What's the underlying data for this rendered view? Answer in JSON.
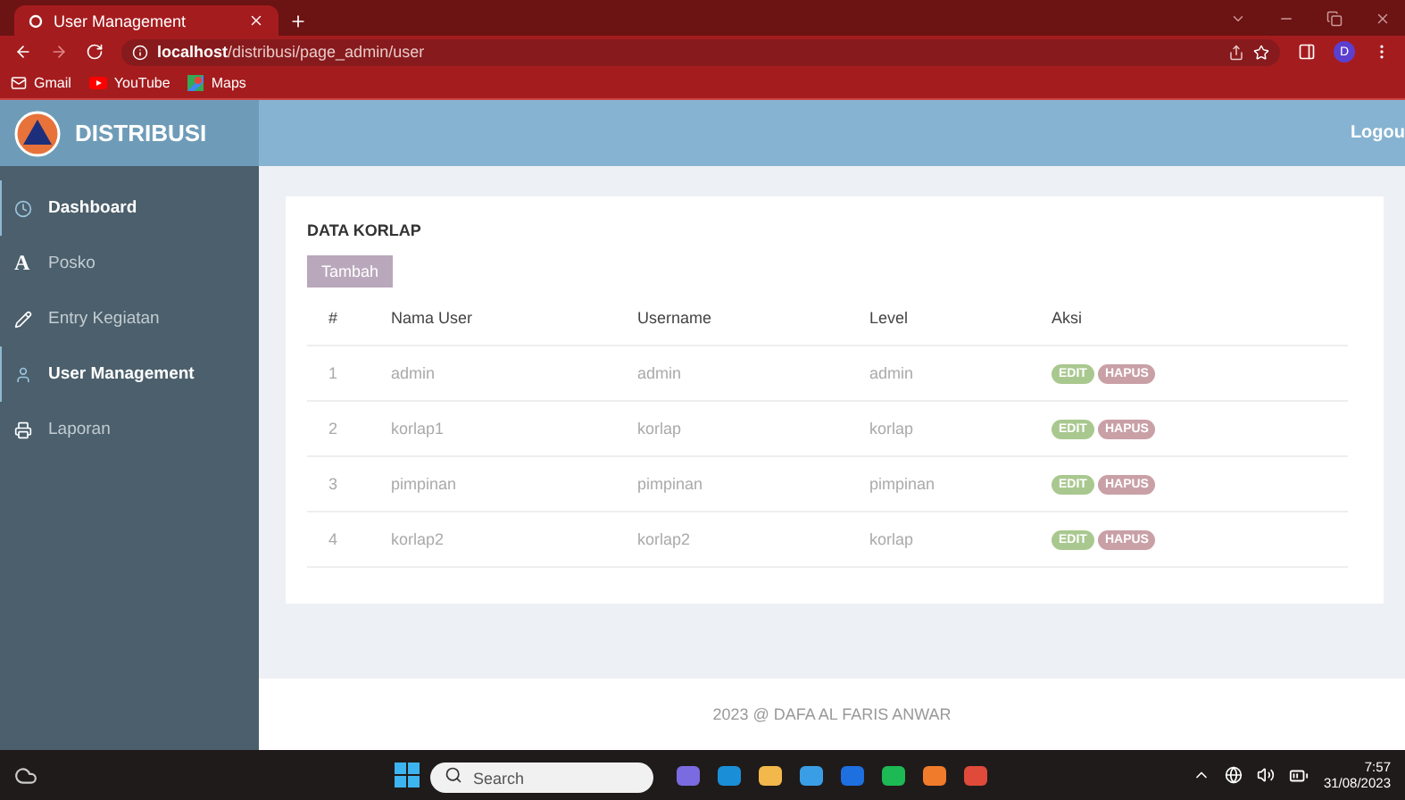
{
  "browser": {
    "tab_title": "User Management",
    "address_host": "localhost",
    "address_path": "/distribusi/page_admin/user",
    "profile_letter": "D",
    "bookmarks": [
      {
        "label": "Gmail"
      },
      {
        "label": "YouTube"
      },
      {
        "label": "Maps"
      }
    ]
  },
  "header": {
    "brand": "DISTRIBUSI",
    "logout": "Logou"
  },
  "sidebar": {
    "items": [
      {
        "label": "Dashboard",
        "active": true
      },
      {
        "label": "Posko",
        "active": false,
        "glyph": "A"
      },
      {
        "label": "Entry Kegiatan",
        "active": false
      },
      {
        "label": "User Management",
        "active": true
      },
      {
        "label": "Laporan",
        "active": false
      }
    ]
  },
  "content": {
    "title": "DATA KORLAP",
    "add_button": "Tambah",
    "table": {
      "columns": [
        "#",
        "Nama User",
        "Username",
        "Level",
        "Aksi"
      ],
      "rows": [
        {
          "no": "1",
          "name": "admin",
          "username": "admin",
          "level": "admin",
          "actions": [
            "EDIT",
            "HAPUS"
          ]
        },
        {
          "no": "2",
          "name": "korlap1",
          "username": "korlap",
          "level": "korlap",
          "actions": [
            "EDIT",
            "HAPUS"
          ]
        },
        {
          "no": "3",
          "name": "pimpinan",
          "username": "pimpinan",
          "level": "pimpinan",
          "actions": [
            "EDIT",
            "HAPUS"
          ]
        },
        {
          "no": "4",
          "name": "korlap2",
          "username": "korlap2",
          "level": "korlap",
          "actions": [
            "EDIT",
            "HAPUS"
          ]
        }
      ]
    }
  },
  "footer": "2023 @ DAFA AL FARIS ANWAR",
  "taskbar": {
    "search_placeholder": "Search",
    "time": "7:57",
    "date": "31/08/2023"
  }
}
